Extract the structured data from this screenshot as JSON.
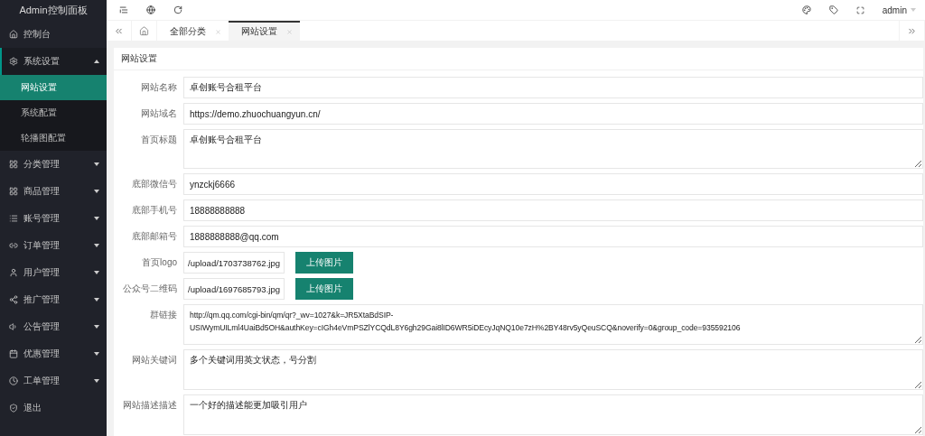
{
  "sidebar": {
    "title": "Admin控制面板",
    "items": [
      {
        "kind": "link",
        "label": "控制台"
      },
      {
        "kind": "group",
        "label": "系统设置",
        "expanded": true,
        "children": [
          {
            "label": "网站设置",
            "selected": true
          },
          {
            "label": "系统配置",
            "selected": false
          },
          {
            "label": "轮播图配置",
            "selected": false
          }
        ]
      },
      {
        "kind": "group",
        "label": "分类管理",
        "expanded": false
      },
      {
        "kind": "group",
        "label": "商品管理",
        "expanded": false
      },
      {
        "kind": "group",
        "label": "账号管理",
        "expanded": false
      },
      {
        "kind": "group",
        "label": "订单管理",
        "expanded": false
      },
      {
        "kind": "group",
        "label": "用户管理",
        "expanded": false
      },
      {
        "kind": "group",
        "label": "推广管理",
        "expanded": false
      },
      {
        "kind": "group",
        "label": "公告管理",
        "expanded": false
      },
      {
        "kind": "group",
        "label": "优惠管理",
        "expanded": false
      },
      {
        "kind": "group",
        "label": "工单管理",
        "expanded": false
      },
      {
        "kind": "link",
        "label": "退出"
      }
    ]
  },
  "header": {
    "user": "admin"
  },
  "tabs": [
    {
      "label": "全部分类",
      "selected": false
    },
    {
      "label": "网站设置",
      "selected": true
    }
  ],
  "card": {
    "title": "网站设置",
    "fields": [
      {
        "kind": "input",
        "label": "网站名称",
        "value": "卓创账号合租平台"
      },
      {
        "kind": "input",
        "label": "网站域名",
        "value": "https://demo.zhuochuangyun.cn/"
      },
      {
        "kind": "textarea",
        "label": "首页标题",
        "value": "卓创账号合租平台"
      },
      {
        "kind": "input",
        "label": "底部微信号",
        "value": "ynzckj6666"
      },
      {
        "kind": "input",
        "label": "底部手机号",
        "value": "18888888888"
      },
      {
        "kind": "input",
        "label": "底部邮箱号",
        "value": "1888888888@qq.com"
      },
      {
        "kind": "upload",
        "label": "首页logo",
        "value": "/upload/1703738762.jpg",
        "button": "上传图片"
      },
      {
        "kind": "upload",
        "label": "公众号二维码",
        "value": "/upload/1697685793.jpg",
        "button": "上传图片"
      },
      {
        "kind": "textarea",
        "label": "群链接",
        "value": "http://qm.qq.com/cgi-bin/qm/qr?_wv=1027&k=JR5XtaBdSIP-USIWymUILml4UaiBd5OH&authKey=cIGh4eVmPSZlYCQdL8Y6gh29Gai8lID6WR5iDEcyJqNQ10e7zH%2BY48rv5yQeuSCQ&noverify=0&group_code=935592106"
      },
      {
        "kind": "textarea",
        "label": "网站关键词",
        "value": "多个关键词用英文状态，号分割"
      },
      {
        "kind": "textarea",
        "label": "网站描述描述",
        "value": "一个好的描述能更加吸引用户"
      }
    ]
  }
}
